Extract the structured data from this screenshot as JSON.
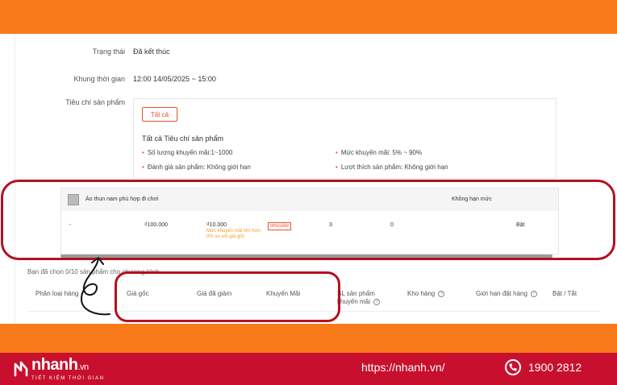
{
  "details": {
    "status_label": "Trạng thái",
    "status_value": "Đã kết thúc",
    "time_label": "Khung thời gian",
    "time_value": "12:00 14/05/2025 ~ 15:00",
    "criteria_label": "Tiêu chí sản phẩm"
  },
  "criteria": {
    "all_button": "Tất cả",
    "title": "Tất cả Tiêu chí sản phẩm",
    "items": [
      "Số lượng khuyến mãi:1~1000",
      "Mức khuyến mãi: 5% ~ 90%",
      "Đánh giá sản phẩm: Không giới hạn",
      "Lượt thích sản phẩm: Không giới hạn"
    ]
  },
  "product": {
    "name": "Áo thun nam phù hợp đi chơi",
    "limit": "Không hạn mức",
    "row": {
      "variant": "-",
      "original_price": "₫100.000",
      "discount_price": "₫10.000",
      "note": "Mức khuyến mãi lớn hơn 0% so với giá gốc",
      "badge": "90%GIẢM",
      "qty": "3",
      "stock": "0",
      "toggle": "Bật"
    }
  },
  "selection": {
    "count_text": "Bạn đã chọn 0/10 sản phẩm cho chương trình"
  },
  "table_headers": {
    "variant": "Phân loại hàng",
    "original_price": "Giá gốc",
    "discount_price": "Giá đã giảm",
    "promotion": "Khuyến Mãi",
    "promo_qty_1": "SL sản phẩm",
    "promo_qty_2": "khuyến mãi",
    "warehouse": "Kho hàng",
    "order_limit": "Giới hạn đặt hàng",
    "toggle": "Bật / Tắt"
  },
  "footer": {
    "brand": "nhanh",
    "brand_suffix": ".vn",
    "tagline": "TIẾT KIỆM THỜI GIAN",
    "url": "https://nhanh.vn/",
    "phone": "1900 2812"
  },
  "colors": {
    "orange": "#f97a1a",
    "footer_red": "#c8102e",
    "highlight": "#b3111f",
    "accent": "#ee4d2d"
  }
}
